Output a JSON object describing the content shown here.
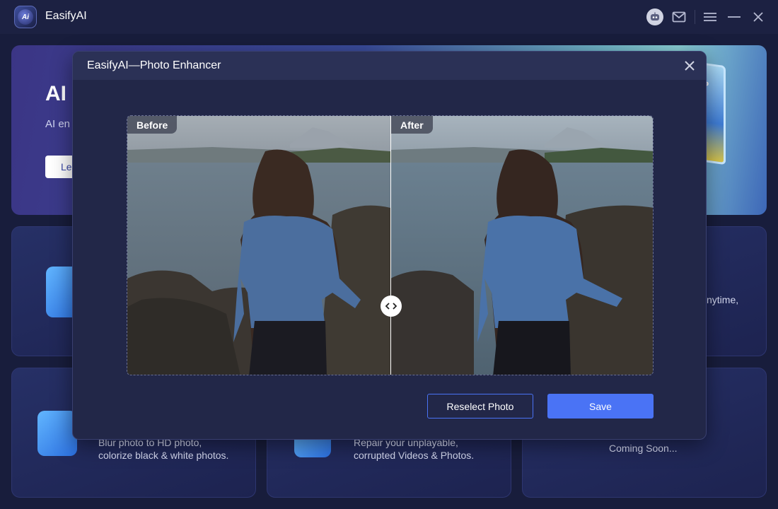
{
  "app": {
    "title": "EasifyAI",
    "logo_text": "Ai"
  },
  "hero": {
    "title": "AI",
    "desc": "AI en video",
    "button": "Le"
  },
  "hero_art_text": "OP",
  "cards": {
    "card3_text": "nytime,",
    "card4_line1": "Blur photo to HD photo,",
    "card4_line2": "colorize black & white photos.",
    "card5_line1": "Repair your unplayable,",
    "card5_line2": "corrupted Videos & Photos.",
    "card6_text": "Coming Soon..."
  },
  "modal": {
    "title": "EasifyAI—Photo  Enhancer",
    "before_label": "Before",
    "after_label": "After",
    "reselect_label": "Reselect  Photo",
    "save_label": "Save"
  },
  "colors": {
    "accent": "#4a73f5",
    "background": "#181d3c",
    "modal_bg": "#222748"
  },
  "icons": [
    "robot-icon",
    "mail-icon",
    "menu-icon",
    "minimize-icon",
    "close-icon",
    "compare-handle-icon"
  ]
}
